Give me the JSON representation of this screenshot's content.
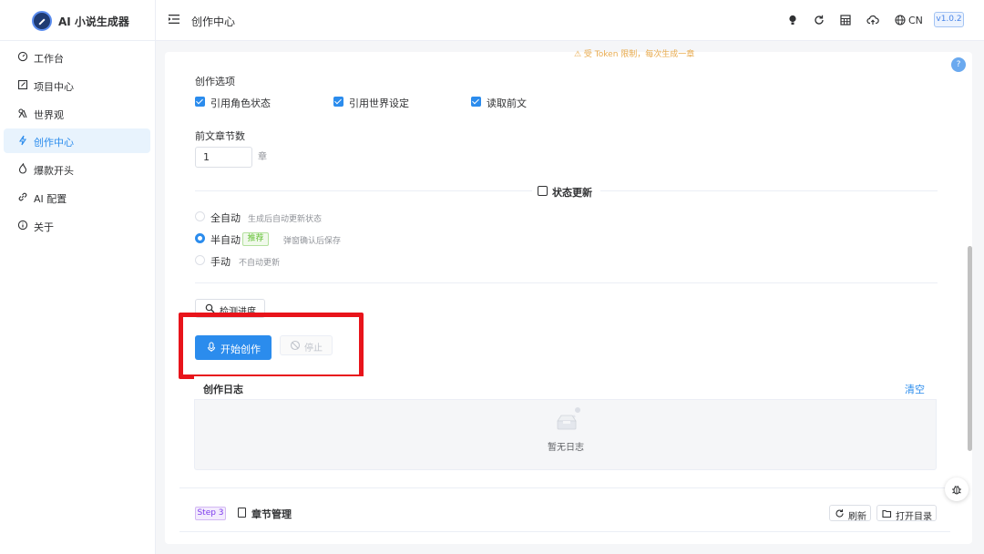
{
  "header": {
    "app_title": "AI 小说生成器",
    "page_title": "创作中心",
    "lang": "CN",
    "version": "v1.0.2",
    "icons": [
      "bulb-icon",
      "refresh-icon",
      "calculator-icon",
      "cloud-upload-icon",
      "globe-icon"
    ]
  },
  "sidebar": {
    "items": [
      {
        "label": "工作台",
        "icon": "dashboard-icon",
        "active": false
      },
      {
        "label": "项目中心",
        "icon": "edit-icon",
        "active": false
      },
      {
        "label": "世界观",
        "icon": "world-icon",
        "active": false
      },
      {
        "label": "创作中心",
        "icon": "lightning-icon",
        "active": true
      },
      {
        "label": "爆款开头",
        "icon": "fire-icon",
        "active": false
      },
      {
        "label": "AI 配置",
        "icon": "link-icon",
        "active": false
      },
      {
        "label": "关于",
        "icon": "info-icon",
        "active": false
      }
    ]
  },
  "main": {
    "warning_text": "⚠ 受 Token 限制，每次生成一章",
    "options": {
      "title": "创作选项",
      "checkboxes": [
        {
          "label": "引用角色状态",
          "checked": true
        },
        {
          "label": "引用世界设定",
          "checked": true
        },
        {
          "label": "读取前文",
          "checked": true
        }
      ]
    },
    "prev_chapters": {
      "label": "前文章节数",
      "value": "1",
      "unit": "章"
    },
    "state_update": {
      "title": "状态更新",
      "modes": [
        {
          "label": "全自动",
          "desc": "生成后自动更新状态",
          "selected": false
        },
        {
          "label": "半自动",
          "tag": "推荐",
          "desc": "弹窗确认后保存",
          "selected": true
        },
        {
          "label": "手动",
          "desc": "不自动更新",
          "selected": false
        }
      ]
    },
    "detect_label": "检测进度",
    "start_label": "开始创作",
    "stop_label": "停止",
    "log": {
      "title": "创作日志",
      "clear_label": "清空",
      "empty_text": "暂无日志"
    },
    "chapters": {
      "step": "Step 3",
      "title": "章节管理",
      "refresh_label": "刷新",
      "open_dir_label": "打开目录"
    }
  },
  "colors": {
    "primary": "#2b8ced",
    "highlight": "#e8141b",
    "success": "#67c23a",
    "purple": "#7c3aed"
  }
}
